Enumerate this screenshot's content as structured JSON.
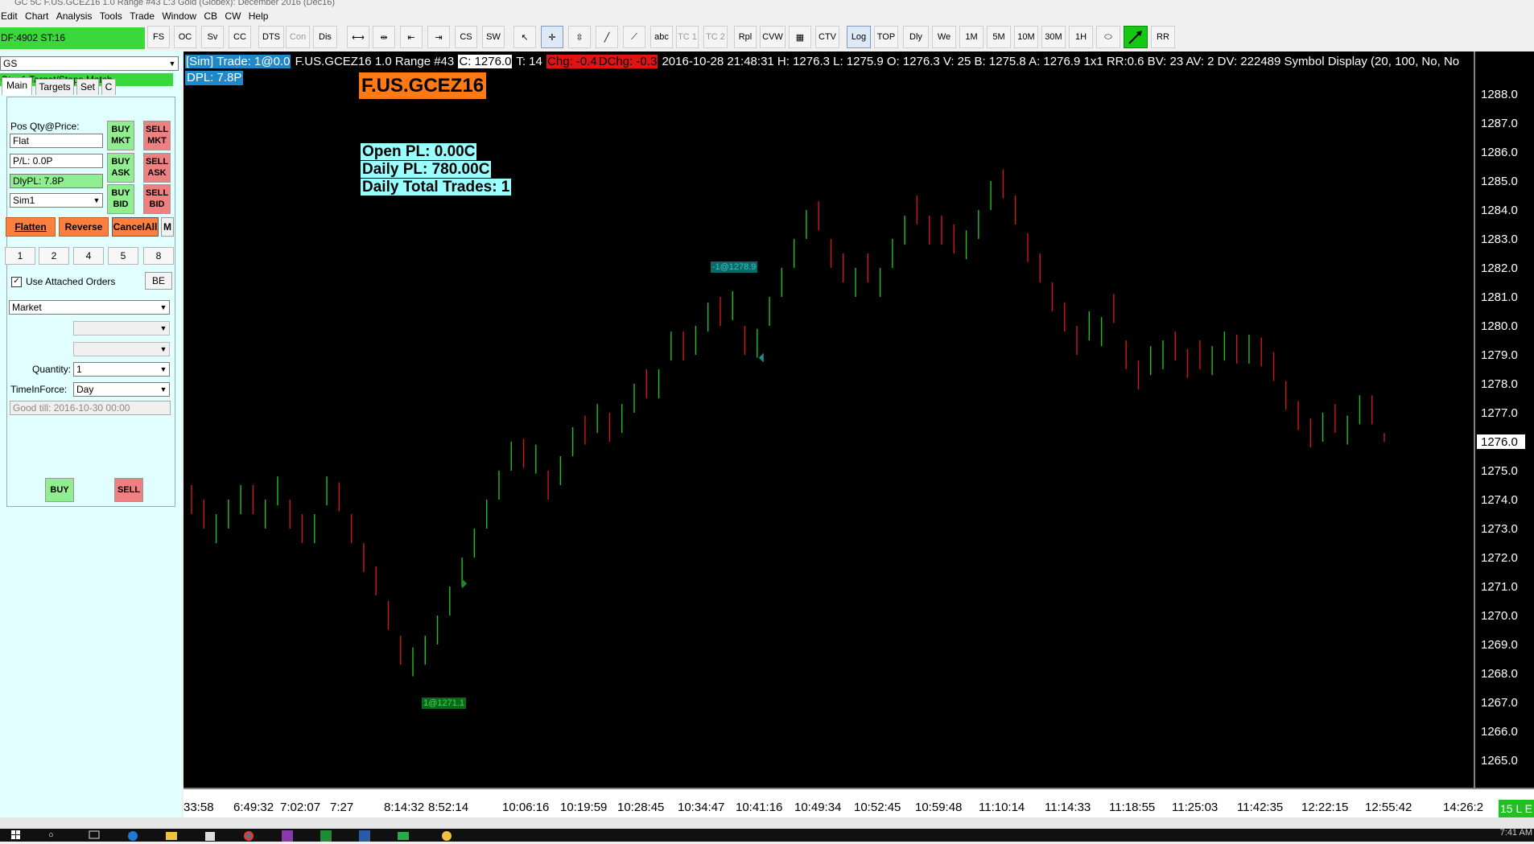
{
  "window": {
    "title": "GC  5C F.US.GCEZ16  1.0 Range  #43  L:3  Gold (Globex): December 2016 (Dec16)"
  },
  "menu": [
    "Edit",
    "Chart",
    "Analysis",
    "Tools",
    "Trade",
    "Window",
    "CB",
    "CW",
    "Help"
  ],
  "toolbar": {
    "df_status": "DF:4902  ST:16",
    "buttons": [
      "FS",
      "OC",
      "Sv",
      "CC",
      "DTS",
      "Con",
      "Dis",
      "CS",
      "SW",
      "abc",
      "TC 1",
      "TC 2",
      "Rpl",
      "CVW",
      "CTV",
      "Log",
      "TOP",
      "Dly",
      "We",
      "1M",
      "5M",
      "10M",
      "30M",
      "1H",
      "RR"
    ]
  },
  "trade_panel": {
    "symbol_select": "GS",
    "match_status": "Qty: 1 Target/Stops Match",
    "tabs": [
      "Main",
      "Targets",
      "Set",
      "C"
    ],
    "pos_label": "Pos Qty@Price:",
    "pos_value": "Flat",
    "pl_value": "P/L: 0.0P",
    "dlypl_value": "DlyPL: 7.8P",
    "account": "Sim1",
    "buy_mkt": "BUY MKT",
    "sell_mkt": "SELL MKT",
    "buy_ask": "BUY ASK",
    "sell_ask": "SELL ASK",
    "buy_bid": "BUY BID",
    "sell_bid": "SELL BID",
    "flatten": "Flatten",
    "reverse": "Reverse",
    "cancel_all": "CancelAll",
    "m_button": "M",
    "qty_buttons": [
      "1",
      "2",
      "4",
      "5",
      "8"
    ],
    "use_attached_orders": "Use Attached Orders",
    "be_button": "BE",
    "order_type": "Market",
    "quantity_label": "Quantity:",
    "quantity_value": "1",
    "tif_label": "TimeInForce:",
    "tif_value": "Day",
    "good_till": "Good till: 2016-10-30 00:00",
    "buy_button": "BUY",
    "sell_button": "SELL"
  },
  "chart_header": {
    "sim_trade": "[Sim]  Trade: 1@0.0",
    "symbol_info": " F.US.GCEZ16  1.0 Range  #43 ",
    "close": "C: 1276.0",
    "trades": " T: 14 ",
    "chg": "Chg: -0.4",
    "dchg": "DChg: -0.3",
    "details": " 2016-10-28 21:48:31  H: 1276.3  L: 1275.9  O: 1276.3  V: 25  B: 1275.8  A: 1276.9  1x1  RR:0.6  BV: 23  AV: 2  DV: 222489  Symbol Display   (20, 100, No, No",
    "dpl": "DPL: 7.8P"
  },
  "chart_overlay": {
    "symbol": "F.US.GCEZ16",
    "open_pl": "Open PL: 0.00C",
    "daily_pl": "Daily PL: 780.00C",
    "daily_trades": "Daily Total Trades: 1",
    "buy_fill_label": "1@1271.1",
    "sell_fill_label": "-1@1278.9",
    "last_price_label": "1276.0",
    "status_corner": "15 L E"
  },
  "chart_data": {
    "type": "bar",
    "subtype": "range-bars",
    "ylim": [
      1264.6,
      1288.5
    ],
    "y_ticks": [
      1288.0,
      1287.0,
      1286.0,
      1285.0,
      1284.0,
      1283.0,
      1282.0,
      1281.0,
      1280.0,
      1279.0,
      1278.0,
      1277.0,
      1276.0,
      1275.0,
      1274.0,
      1273.0,
      1272.0,
      1271.0,
      1270.0,
      1269.0,
      1268.0,
      1267.0,
      1266.0,
      1265.0
    ],
    "x_tick_labels": [
      "33:58",
      "6:49:32",
      "7:02:07",
      "7:27",
      "8:14:32",
      "8:52:14",
      "10:06:16",
      "10:19:59",
      "10:28:45",
      "10:34:47",
      "10:41:16",
      "10:49:34",
      "10:52:45",
      "10:59:48",
      "11:10:14",
      "11:14:33",
      "11:18:55",
      "11:25:03",
      "11:42:35",
      "12:22:15",
      "12:55:42",
      "14:26:2"
    ],
    "bars": [
      {
        "o": 1274.5,
        "c": 1273.5
      },
      {
        "o": 1274.0,
        "c": 1273.0
      },
      {
        "o": 1272.5,
        "c": 1273.5
      },
      {
        "o": 1273.0,
        "c": 1274.0
      },
      {
        "o": 1273.5,
        "c": 1274.5
      },
      {
        "o": 1274.5,
        "c": 1273.5
      },
      {
        "o": 1273.0,
        "c": 1274.0
      },
      {
        "o": 1273.8,
        "c": 1274.8
      },
      {
        "o": 1274.0,
        "c": 1273.0
      },
      {
        "o": 1273.5,
        "c": 1272.5
      },
      {
        "o": 1272.5,
        "c": 1273.5
      },
      {
        "o": 1273.8,
        "c": 1274.8
      },
      {
        "o": 1274.6,
        "c": 1273.6
      },
      {
        "o": 1273.5,
        "c": 1272.5
      },
      {
        "o": 1272.5,
        "c": 1271.5
      },
      {
        "o": 1271.7,
        "c": 1270.7
      },
      {
        "o": 1270.5,
        "c": 1269.5
      },
      {
        "o": 1269.3,
        "c": 1268.3
      },
      {
        "o": 1267.9,
        "c": 1268.9
      },
      {
        "o": 1268.3,
        "c": 1269.3
      },
      {
        "o": 1269.0,
        "c": 1270.0
      },
      {
        "o": 1270.0,
        "c": 1271.0
      },
      {
        "o": 1271.0,
        "c": 1272.0
      },
      {
        "o": 1272.0,
        "c": 1273.0
      },
      {
        "o": 1273.0,
        "c": 1274.0
      },
      {
        "o": 1274.0,
        "c": 1275.0
      },
      {
        "o": 1275.0,
        "c": 1276.0
      },
      {
        "o": 1276.1,
        "c": 1275.1
      },
      {
        "o": 1274.9,
        "c": 1275.9
      },
      {
        "o": 1275.0,
        "c": 1274.0
      },
      {
        "o": 1274.5,
        "c": 1275.5
      },
      {
        "o": 1275.5,
        "c": 1276.5
      },
      {
        "o": 1276.9,
        "c": 1275.9
      },
      {
        "o": 1276.3,
        "c": 1277.3
      },
      {
        "o": 1277.0,
        "c": 1276.0
      },
      {
        "o": 1276.3,
        "c": 1277.3
      },
      {
        "o": 1277.0,
        "c": 1278.0
      },
      {
        "o": 1278.5,
        "c": 1277.5
      },
      {
        "o": 1277.5,
        "c": 1278.5
      },
      {
        "o": 1278.8,
        "c": 1279.8
      },
      {
        "o": 1279.8,
        "c": 1278.8
      },
      {
        "o": 1279.0,
        "c": 1280.0
      },
      {
        "o": 1279.8,
        "c": 1280.8
      },
      {
        "o": 1281.0,
        "c": 1280.0
      },
      {
        "o": 1280.2,
        "c": 1281.2
      },
      {
        "o": 1280.0,
        "c": 1279.0
      },
      {
        "o": 1278.9,
        "c": 1279.9
      },
      {
        "o": 1280.0,
        "c": 1281.0
      },
      {
        "o": 1281.0,
        "c": 1282.0
      },
      {
        "o": 1282.0,
        "c": 1283.0
      },
      {
        "o": 1283.0,
        "c": 1284.0
      },
      {
        "o": 1284.3,
        "c": 1283.3
      },
      {
        "o": 1283.0,
        "c": 1282.0
      },
      {
        "o": 1282.5,
        "c": 1281.5
      },
      {
        "o": 1281.0,
        "c": 1282.0
      },
      {
        "o": 1282.5,
        "c": 1281.5
      },
      {
        "o": 1281.0,
        "c": 1282.0
      },
      {
        "o": 1282.0,
        "c": 1283.0
      },
      {
        "o": 1282.8,
        "c": 1283.8
      },
      {
        "o": 1284.5,
        "c": 1283.5
      },
      {
        "o": 1283.8,
        "c": 1282.8
      },
      {
        "o": 1283.8,
        "c": 1282.8
      },
      {
        "o": 1283.5,
        "c": 1282.5
      },
      {
        "o": 1282.3,
        "c": 1283.3
      },
      {
        "o": 1283.0,
        "c": 1284.0
      },
      {
        "o": 1284.0,
        "c": 1285.0
      },
      {
        "o": 1285.4,
        "c": 1284.4
      },
      {
        "o": 1284.5,
        "c": 1283.5
      },
      {
        "o": 1283.2,
        "c": 1282.2
      },
      {
        "o": 1282.5,
        "c": 1281.5
      },
      {
        "o": 1281.5,
        "c": 1280.5
      },
      {
        "o": 1280.8,
        "c": 1279.8
      },
      {
        "o": 1280.0,
        "c": 1279.0
      },
      {
        "o": 1279.5,
        "c": 1280.5
      },
      {
        "o": 1279.3,
        "c": 1280.3
      },
      {
        "o": 1281.1,
        "c": 1280.1
      },
      {
        "o": 1279.5,
        "c": 1278.5
      },
      {
        "o": 1278.8,
        "c": 1277.8
      },
      {
        "o": 1278.3,
        "c": 1279.3
      },
      {
        "o": 1278.5,
        "c": 1279.5
      },
      {
        "o": 1279.8,
        "c": 1278.8
      },
      {
        "o": 1279.2,
        "c": 1278.2
      },
      {
        "o": 1279.5,
        "c": 1278.5
      },
      {
        "o": 1278.3,
        "c": 1279.3
      },
      {
        "o": 1278.8,
        "c": 1279.8
      },
      {
        "o": 1279.7,
        "c": 1278.7
      },
      {
        "o": 1278.7,
        "c": 1279.7
      },
      {
        "o": 1279.6,
        "c": 1278.6
      },
      {
        "o": 1279.1,
        "c": 1278.1
      },
      {
        "o": 1278.1,
        "c": 1277.1
      },
      {
        "o": 1277.4,
        "c": 1276.4
      },
      {
        "o": 1276.8,
        "c": 1275.8
      },
      {
        "o": 1276.0,
        "c": 1277.0
      },
      {
        "o": 1277.3,
        "c": 1276.3
      },
      {
        "o": 1275.9,
        "c": 1276.9
      },
      {
        "o": 1276.6,
        "c": 1277.6
      },
      {
        "o": 1277.6,
        "c": 1276.6
      },
      {
        "o": 1276.3,
        "c": 1276.0
      }
    ],
    "markers": [
      {
        "bar": 22,
        "price": 1271.1,
        "side": "buy"
      },
      {
        "bar": 46,
        "price": 1278.9,
        "side": "sell"
      }
    ],
    "last_price": 1276.0,
    "colors": {
      "up": "#22c022",
      "down": "#d01818",
      "background": "#000000",
      "axis_text": "#ffffff"
    }
  },
  "taskbar": {
    "clock": "7:41 AM"
  }
}
